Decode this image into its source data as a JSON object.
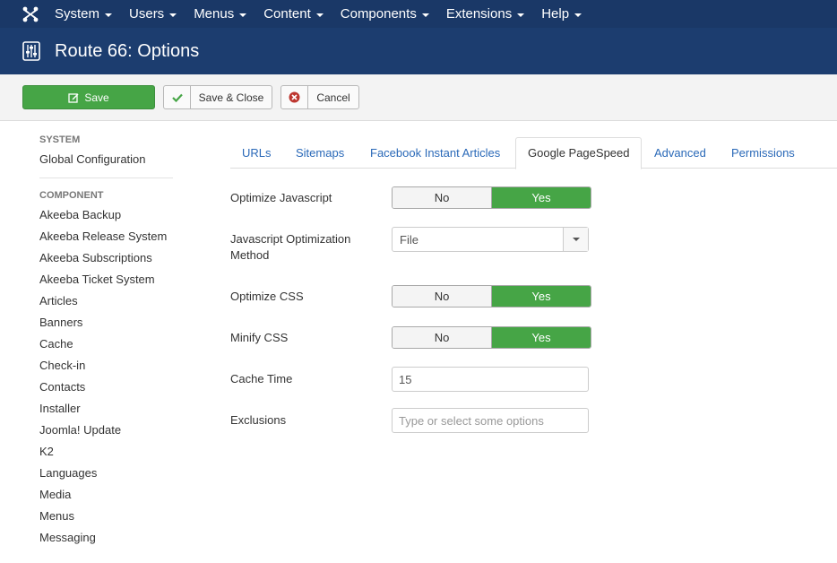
{
  "topnav": {
    "items": [
      {
        "label": "System"
      },
      {
        "label": "Users"
      },
      {
        "label": "Menus"
      },
      {
        "label": "Content"
      },
      {
        "label": "Components"
      },
      {
        "label": "Extensions"
      },
      {
        "label": "Help"
      }
    ]
  },
  "header": {
    "title": "Route 66: Options",
    "icon": "options-sliders-icon"
  },
  "toolbar": {
    "save_label": "Save",
    "save_close_label": "Save & Close",
    "cancel_label": "Cancel"
  },
  "sidebar": {
    "system_heading": "SYSTEM",
    "system_items": [
      {
        "label": "Global Configuration"
      }
    ],
    "component_heading": "COMPONENT",
    "component_items": [
      {
        "label": "Akeeba Backup"
      },
      {
        "label": "Akeeba Release System"
      },
      {
        "label": "Akeeba Subscriptions"
      },
      {
        "label": "Akeeba Ticket System"
      },
      {
        "label": "Articles"
      },
      {
        "label": "Banners"
      },
      {
        "label": "Cache"
      },
      {
        "label": "Check-in"
      },
      {
        "label": "Contacts"
      },
      {
        "label": "Installer"
      },
      {
        "label": "Joomla! Update"
      },
      {
        "label": "K2"
      },
      {
        "label": "Languages"
      },
      {
        "label": "Media"
      },
      {
        "label": "Menus"
      },
      {
        "label": "Messaging"
      }
    ]
  },
  "tabs": [
    {
      "label": "URLs",
      "active": false
    },
    {
      "label": "Sitemaps",
      "active": false
    },
    {
      "label": "Facebook Instant Articles",
      "active": false
    },
    {
      "label": "Google PageSpeed",
      "active": true
    },
    {
      "label": "Advanced",
      "active": false
    },
    {
      "label": "Permissions",
      "active": false
    }
  ],
  "form": {
    "optimize_js": {
      "label": "Optimize Javascript",
      "no": "No",
      "yes": "Yes",
      "value": "Yes"
    },
    "js_method": {
      "label": "Javascript Optimization Method",
      "value": "File"
    },
    "optimize_css": {
      "label": "Optimize CSS",
      "no": "No",
      "yes": "Yes",
      "value": "Yes"
    },
    "minify_css": {
      "label": "Minify CSS",
      "no": "No",
      "yes": "Yes",
      "value": "Yes"
    },
    "cache_time": {
      "label": "Cache Time",
      "value": "15"
    },
    "exclusions": {
      "label": "Exclusions",
      "value": "",
      "placeholder": "Type or select some options"
    }
  },
  "colors": {
    "topnav_bg": "#1a3867",
    "header_bg": "#1c3d6f",
    "success_green": "#46a546",
    "link_blue": "#2a69b8",
    "cancel_red": "#bd362f"
  }
}
